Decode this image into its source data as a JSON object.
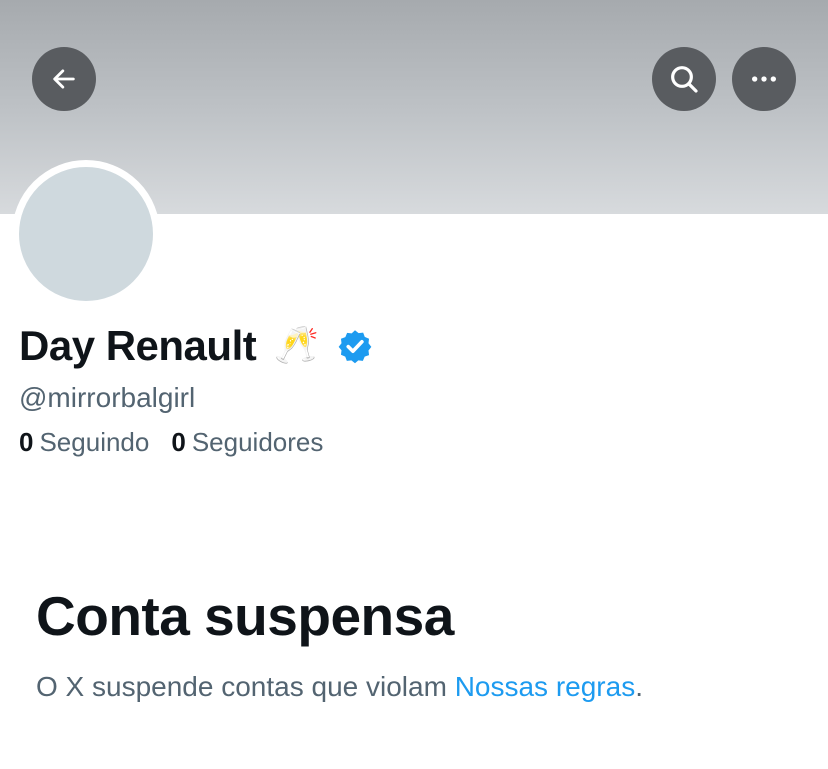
{
  "header": {
    "back_icon": "arrow-left-icon",
    "search_icon": "search-icon",
    "more_icon": "more-horizontal-icon"
  },
  "profile": {
    "display_name": "Day Renault",
    "emoji": "🥂",
    "verified_icon": "verified-badge-icon",
    "handle": "@mirrorbalgirl",
    "following_count": "0",
    "following_label": "Seguindo",
    "followers_count": "0",
    "followers_label": "Seguidores"
  },
  "suspension": {
    "title": "Conta suspensa",
    "text_before": "O X suspende contas que violam ",
    "link_text": "Nossas regras",
    "text_after": "."
  },
  "colors": {
    "primary_text": "#0f1419",
    "secondary_text": "#536471",
    "link": "#1d9bf0",
    "verified": "#1d9bf0",
    "button_bg": "#595c60",
    "avatar_bg": "#cfd9de"
  }
}
